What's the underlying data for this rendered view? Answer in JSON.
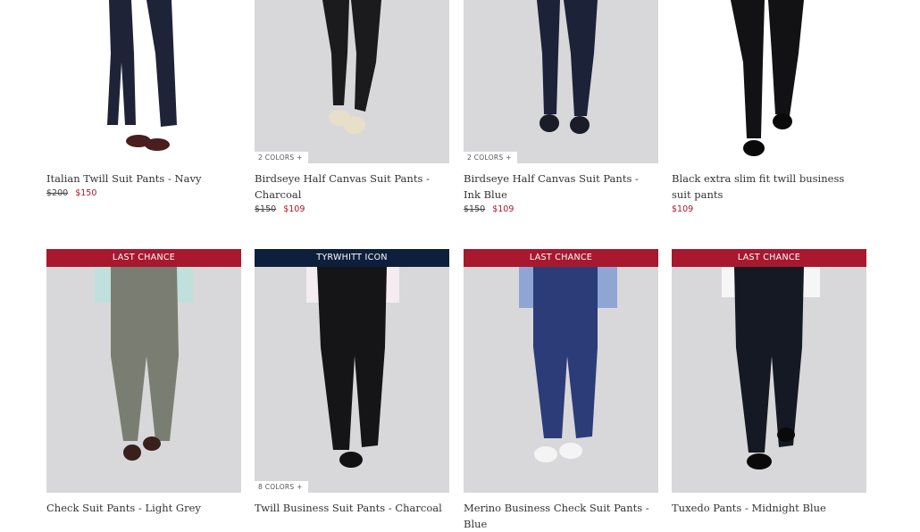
{
  "products_row1": [
    {
      "title": "Italian Twill Suit Pants - Navy",
      "old_price": "$200",
      "price": "$150",
      "colors": ""
    },
    {
      "title": "Birdseye Half Canvas Suit Pants - Charcoal",
      "old_price": "$150",
      "price": "$109",
      "colors": "2 COLORS +"
    },
    {
      "title": "Birdseye Half Canvas Suit Pants - Ink Blue",
      "old_price": "$150",
      "price": "$109",
      "colors": "2 COLORS +"
    },
    {
      "title": "Black extra slim fit twill business suit pants",
      "old_price": "",
      "price": "$109",
      "colors": ""
    }
  ],
  "products_row2": [
    {
      "title": "Check Suit Pants - Light Grey",
      "badge": "LAST CHANCE",
      "colors": ""
    },
    {
      "title": "Twill Business Suit Pants - Charcoal",
      "badge": "TYRWHITT ICON",
      "colors": "8 COLORS +"
    },
    {
      "title": "Merino Business Check Suit Pants - Blue",
      "badge": "LAST CHANCE",
      "colors": ""
    },
    {
      "title": "Tuxedo Pants - Midnight Blue",
      "badge": "LAST CHANCE",
      "colors": ""
    }
  ],
  "colors": {
    "badge_red": "#a8182e",
    "badge_navy": "#0d1f3c",
    "sale_price": "#a8182e",
    "image_bg": "#d8d8da"
  }
}
